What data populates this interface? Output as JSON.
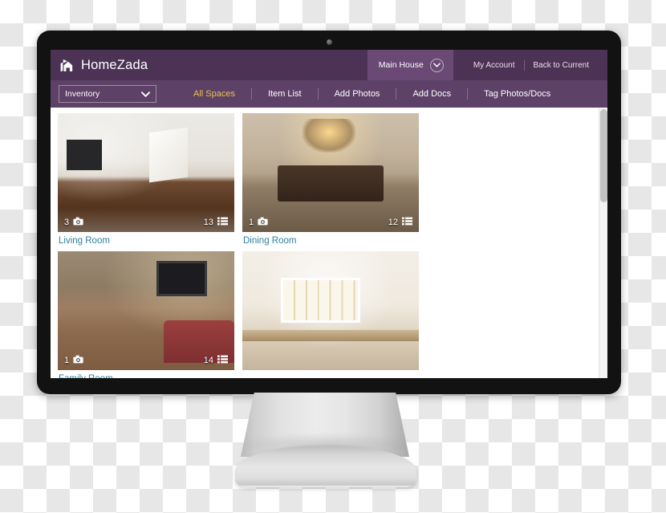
{
  "app": {
    "brand_name": "HomeZada",
    "logo_icon": "house-flag-icon"
  },
  "header": {
    "house_selector": {
      "label": "Main House",
      "icon": "chevron-down-icon"
    },
    "links": [
      {
        "label": "My Account"
      },
      {
        "label": "Back to Current"
      }
    ]
  },
  "nav": {
    "module_select": {
      "value": "Inventory",
      "icon": "caret-down-icon"
    },
    "items": [
      {
        "label": "All Spaces",
        "active": true
      },
      {
        "label": "Item List",
        "active": false
      },
      {
        "label": "Add Photos",
        "active": false
      },
      {
        "label": "Add Docs",
        "active": false
      },
      {
        "label": "Tag Photos/Docs",
        "active": false
      }
    ]
  },
  "content": {
    "photo_count_icon": "camera-icon",
    "item_count_icon": "list-icon",
    "cards": [
      {
        "title": "Living Room",
        "photo_count": "3",
        "item_count": "13",
        "scene": "scene-living"
      },
      {
        "title": "Dining Room",
        "photo_count": "1",
        "item_count": "12",
        "scene": "scene-dining"
      },
      {
        "title": "Family Room",
        "photo_count": "1",
        "item_count": "14",
        "scene": "scene-family"
      },
      {
        "title": "",
        "photo_count": "",
        "item_count": "",
        "scene": "scene-kitchen"
      },
      {
        "title": "",
        "photo_count": "",
        "item_count": "",
        "scene": "scene-nook"
      },
      {
        "title": "",
        "photo_count": "",
        "item_count": "",
        "scene": "scene-bedroom"
      }
    ]
  },
  "colors": {
    "header_purple": "#4c3355",
    "nav_purple": "#5d4167",
    "selector_purple": "#6a4a74",
    "active_gold": "#e8c44a",
    "link_teal": "#2a7f9e",
    "bezel_black": "#121212"
  }
}
